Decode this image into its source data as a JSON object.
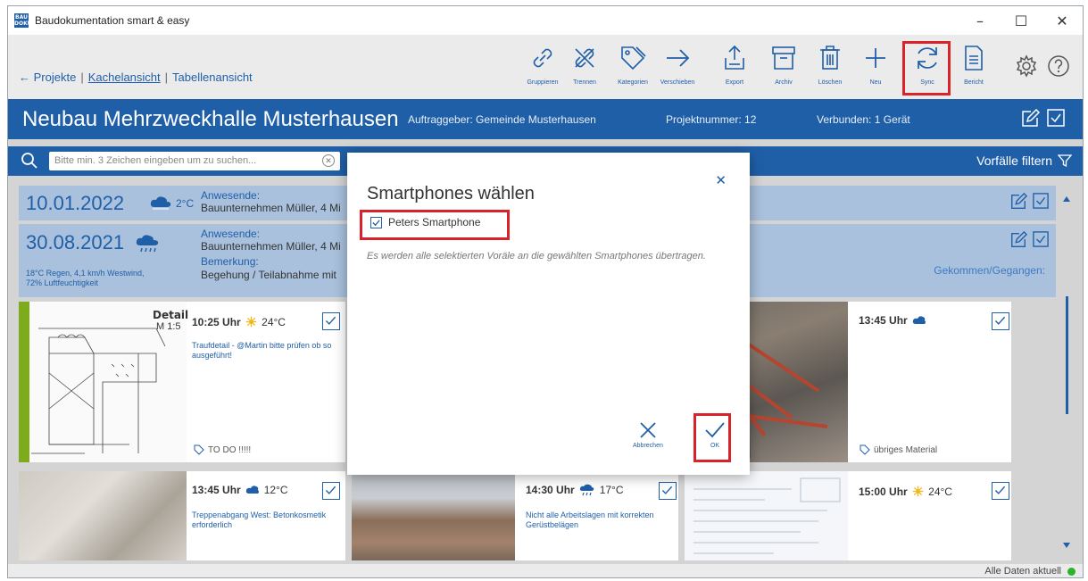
{
  "app": {
    "title": "Baudokumentation smart & easy",
    "icon_text": "BAU DOKU"
  },
  "window_controls": [
    "–",
    "☐",
    "✕"
  ],
  "breadcrumb": {
    "projects": "← Projekte",
    "sep": "|",
    "tiles": "Kachelansicht",
    "table": "Tabellenansicht"
  },
  "toolbar": [
    {
      "label": "Gruppieren",
      "icon": "link-icon"
    },
    {
      "label": "Trennen",
      "icon": "unlink-icon"
    },
    {
      "label": "Kategorien",
      "icon": "tag-icon"
    },
    {
      "label": "Verschieben",
      "icon": "arrow-right-icon"
    },
    {
      "label": "Export",
      "icon": "export-icon"
    },
    {
      "label": "Archiv",
      "icon": "archive-icon"
    },
    {
      "label": "Löschen",
      "icon": "trash-icon"
    },
    {
      "label": "Neu",
      "icon": "plus-icon"
    },
    {
      "label": "Sync",
      "icon": "sync-icon"
    },
    {
      "label": "Bericht",
      "icon": "report-icon"
    }
  ],
  "project": {
    "title": "Neubau Mehrzweckhalle Musterhausen",
    "client": "Auftraggeber: Gemeinde Musterhausen",
    "number": "Projektnummer: 12",
    "connected": "Verbunden: 1 Gerät"
  },
  "search": {
    "placeholder": "Bitte min. 3 Zeichen eingeben um zu suchen...",
    "clear": "✕",
    "filter_label": "Vorfälle filtern"
  },
  "days": [
    {
      "date": "10.01.2022",
      "temp": "2°C",
      "attendees_label": "Anwesende:",
      "attendees": "Bauunternehmen Müller, 4 Mi"
    },
    {
      "date": "30.08.2021",
      "weather": "18°C Regen, 4,1 km/h Westwind,",
      "humidity": "72% Luftfeuchtigkeit",
      "attendees_label": "Anwesende:",
      "attendees": "Bauunternehmen Müller, 4 Mi",
      "remark_label": "Bemerkung:",
      "remark": "Begehung / Teilabnahme mit",
      "gekommen": "Gekommen/Gegangen:"
    }
  ],
  "tiles": [
    {
      "time": "10:25 Uhr",
      "temp": "24°C",
      "desc": "Traufdetail - @Martin bitte prüfen ob so ausgeführt!",
      "tag": "TO DO !!!!!",
      "drawing_title": "Detail",
      "drawing_scale": "M 1:5"
    },
    {
      "time": "13:45 Uhr",
      "temp": "",
      "desc": "",
      "tag": "übriges Material"
    },
    {
      "time": "13:45 Uhr",
      "temp": "12°C",
      "desc": "Treppenabgang West: Betonkosmetik erforderlich",
      "tag": ""
    },
    {
      "time": "14:30 Uhr",
      "temp": "17°C",
      "desc": "Nicht alle Arbeitslagen mit korrekten Gerüstbelägen",
      "tag": ""
    },
    {
      "time": "15:00 Uhr",
      "temp": "24°C",
      "desc": "",
      "tag": ""
    }
  ],
  "status": {
    "text": "Alle Daten aktuell",
    "dot_color": "#2bb32b"
  },
  "modal": {
    "title": "Smartphones wählen",
    "phone": "Peters Smartphone",
    "phone_checked": true,
    "info": "Es werden alle selektierten Voräle an die gewählten Smartphones übertragen.",
    "cancel": "Abbrechen",
    "ok": "OK"
  },
  "colors": {
    "brand": "#1f5fa8",
    "header_light": "#a9c1dd",
    "highlight": "#d9232a"
  }
}
